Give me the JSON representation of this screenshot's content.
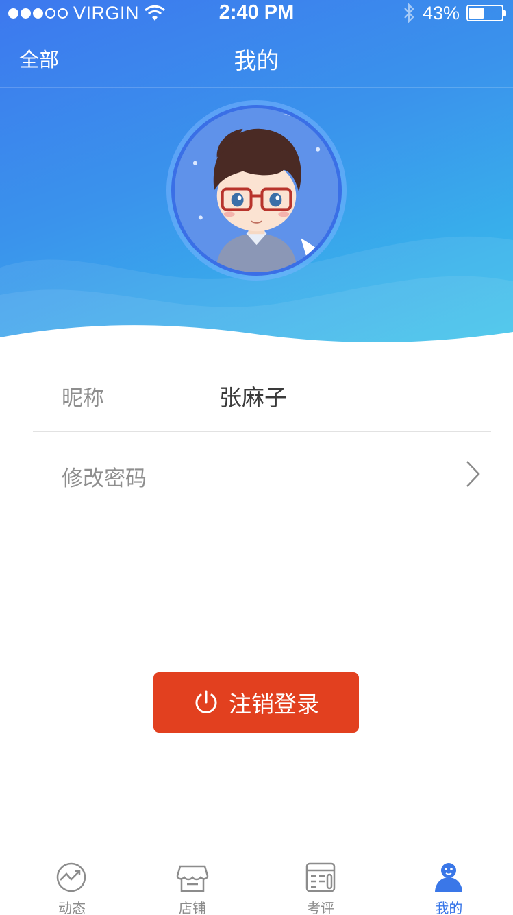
{
  "status_bar": {
    "carrier": "VIRGIN",
    "time": "2:40 PM",
    "battery": "43%",
    "battery_level": 0.43,
    "signal_bars_filled": 3,
    "signal_bars_total": 5
  },
  "nav": {
    "left_label": "全部",
    "title": "我的"
  },
  "profile": {
    "nickname_label": "昵称",
    "nickname_value": "张麻子",
    "change_password_label": "修改密码"
  },
  "logout": {
    "label": "注销登录"
  },
  "tabs": [
    {
      "label": "动态",
      "icon": "trend-icon",
      "active": false
    },
    {
      "label": "店铺",
      "icon": "store-icon",
      "active": false
    },
    {
      "label": "考评",
      "icon": "review-icon",
      "active": false
    },
    {
      "label": "我的",
      "icon": "user-icon",
      "active": true
    }
  ],
  "colors": {
    "header_start": "#3d78ee",
    "header_end": "#37c3ea",
    "accent": "#3a77e8",
    "logout": "#e2401f",
    "inactive_tab": "#8c8c8c"
  }
}
